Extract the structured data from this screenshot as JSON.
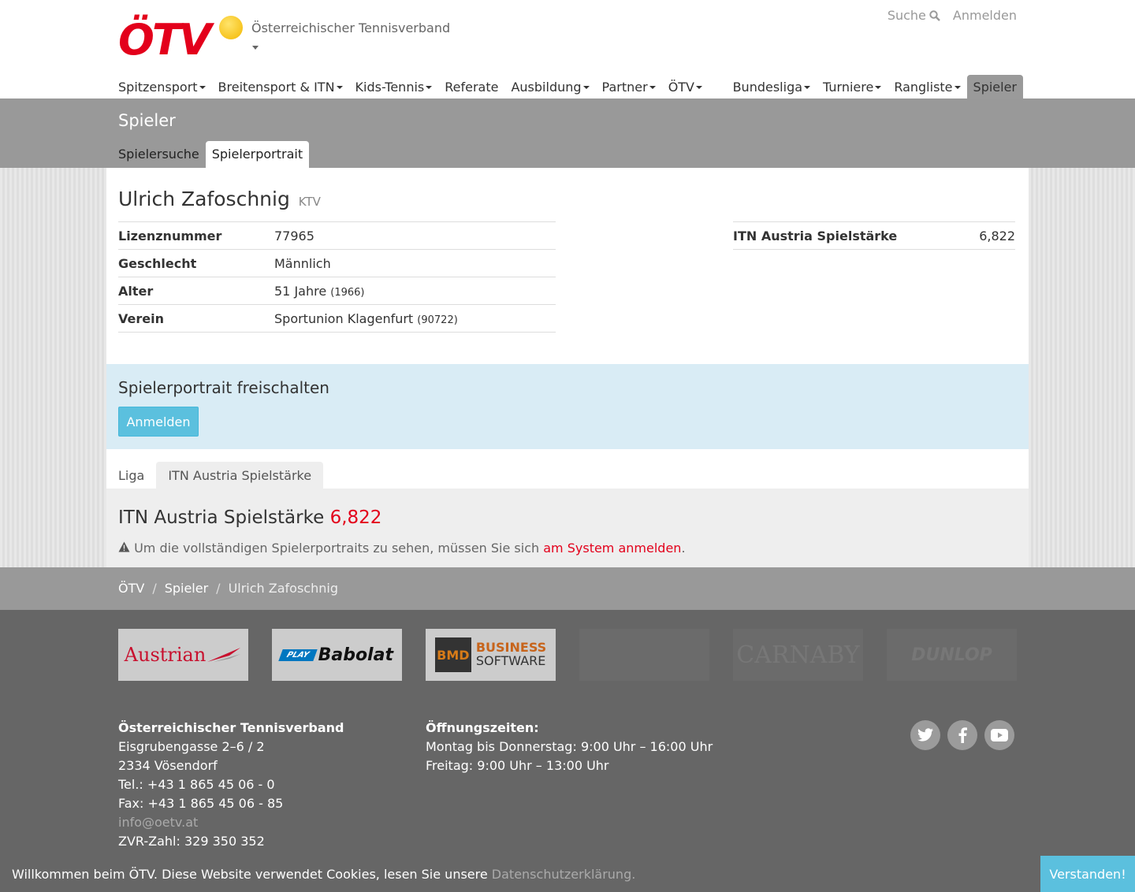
{
  "brand": {
    "logo_text": "ÖTV",
    "org_name": "Österreichischer Tennisverband"
  },
  "util_nav": {
    "search": "Suche",
    "login": "Anmelden"
  },
  "main_nav_left": [
    {
      "label": "Spitzensport",
      "dropdown": true
    },
    {
      "label": "Breitensport & ITN",
      "dropdown": true
    },
    {
      "label": "Kids-Tennis",
      "dropdown": true
    },
    {
      "label": "Referate",
      "dropdown": false
    },
    {
      "label": "Ausbildung",
      "dropdown": true
    },
    {
      "label": "Partner",
      "dropdown": true
    },
    {
      "label": "ÖTV",
      "dropdown": true
    }
  ],
  "main_nav_right": [
    {
      "label": "Bundesliga",
      "dropdown": true
    },
    {
      "label": "Turniere",
      "dropdown": true
    },
    {
      "label": "Rangliste",
      "dropdown": true
    },
    {
      "label": "Spieler",
      "dropdown": false,
      "active": true
    }
  ],
  "section": {
    "title": "Spieler",
    "tabs": [
      "Spielersuche",
      "Spielerportrait"
    ],
    "active_tab": "Spielerportrait"
  },
  "player": {
    "name": "Ulrich Zafoschnig",
    "club_abbr": "KTV",
    "rows": [
      {
        "label": "Lizenznummer",
        "value": "77965",
        "extra": ""
      },
      {
        "label": "Geschlecht",
        "value": "Männlich",
        "extra": ""
      },
      {
        "label": "Alter",
        "value": "51 Jahre",
        "extra": "(1966)"
      },
      {
        "label": "Verein",
        "value": "Sportunion Klagenfurt",
        "extra": "(90722)"
      }
    ],
    "itn_label": "ITN Austria Spielstärke",
    "itn_value": "6,822"
  },
  "unlock": {
    "title": "Spielerportrait freischalten",
    "button": "Anmelden"
  },
  "detail_tabs": [
    "Liga",
    "ITN Austria Spielstärke"
  ],
  "itn_panel": {
    "title": "ITN Austria Spielstärke",
    "value": "6,822",
    "notice": "Um die vollständigen Spielerportraits zu sehen, müssen Sie sich",
    "notice_link": "am System anmelden",
    "notice_end": "."
  },
  "breadcrumb": [
    "ÖTV",
    "Spieler",
    "Ulrich Zafoschnig"
  ],
  "sponsors": {
    "austrian": "Austrian",
    "babolat_play": "PLAY",
    "babolat": "Babolat",
    "bms_box": "BMD",
    "bms_1": "BUSINESS",
    "bms_2": "SOFTWARE",
    "carnaby": "CARNABY",
    "dunlop": "DUNLOP"
  },
  "footer": {
    "org": "Österreichischer Tennisverband",
    "street": "Eisgrubengasse 2–6 / 2",
    "city": "2334 Vösendorf",
    "tel": "Tel.: +43 1 865 45 06 - 0",
    "fax": "Fax: +43 1 865 45 06 - 85",
    "email": "info@oetv.at",
    "zvr": "ZVR-Zahl: 329 350 352",
    "hours_title": "Öffnungszeiten:",
    "hours_1": "Montag bis Donnerstag: 9:00 Uhr – 16:00 Uhr",
    "hours_2": "Freitag: 9:00 Uhr – 13:00 Uhr",
    "social": [
      "twitter-icon",
      "facebook-icon",
      "youtube-icon"
    ]
  },
  "cookie": {
    "message": "Willkommen beim ÖTV. Diese Website verwendet Cookies, lesen Sie unsere",
    "link": "Datenschutzerklärung.",
    "accept": "Verstanden!"
  }
}
